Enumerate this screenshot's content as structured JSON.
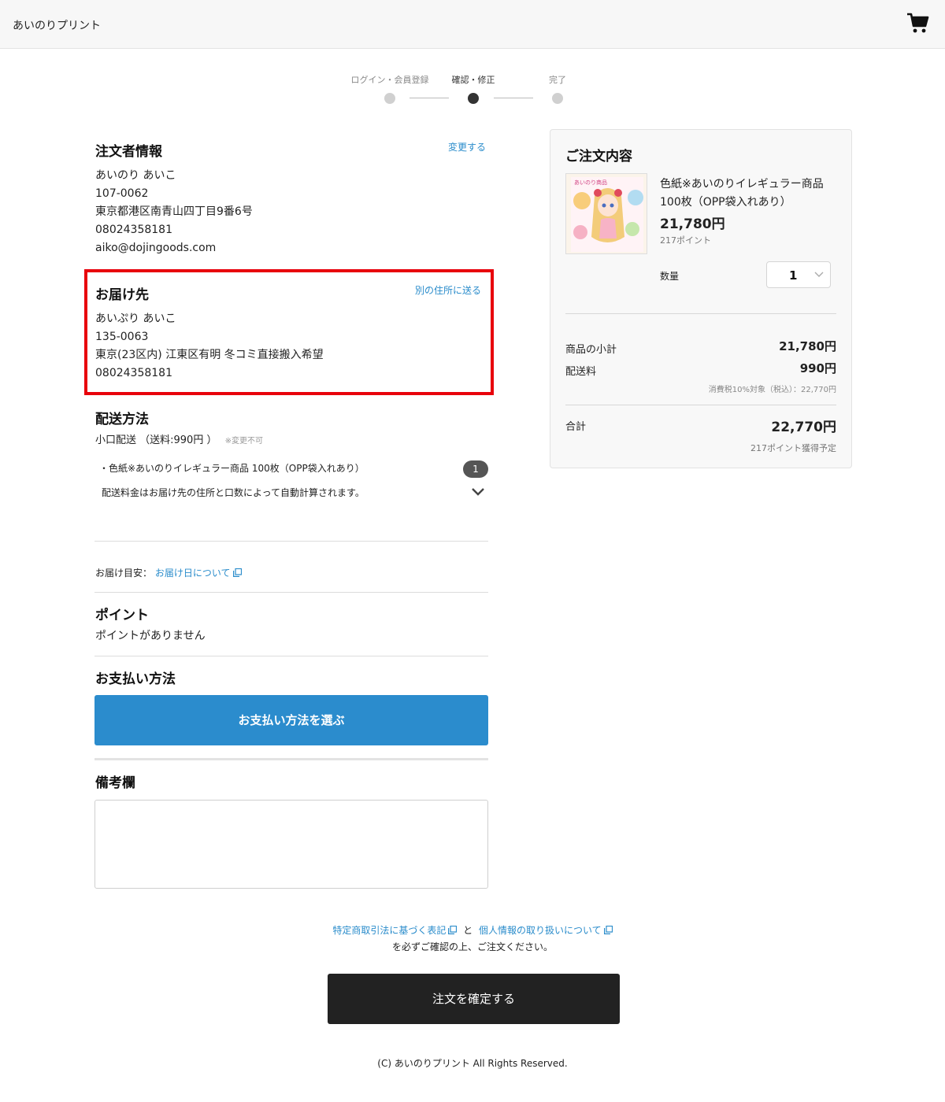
{
  "header": {
    "store_name": "あいのりプリント",
    "cart_icon": "cart-icon"
  },
  "stepper": {
    "steps": [
      {
        "label": "ログイン・会員登録",
        "state": "done"
      },
      {
        "label": "確認・修正",
        "state": "current"
      },
      {
        "label": "完了",
        "state": "pending"
      }
    ]
  },
  "orderer": {
    "title": "注文者情報",
    "change_link": "変更する",
    "name": "あいのり あいこ",
    "postal": "107-0062",
    "address": "東京都港区南青山四丁目9番6号",
    "phone": "08024358181",
    "email": "aiko@dojingoods.com"
  },
  "delivery": {
    "title": "お届け先",
    "alt_link": "別の住所に送る",
    "name": "あいぷり あいこ",
    "postal": "135-0063",
    "address": "東京(23区内) 江東区有明 冬コミ直接搬入希望",
    "phone": "08024358181"
  },
  "shipping": {
    "title": "配送方法",
    "method": "小口配送 （送料:990円 ）",
    "note": "※変更不可",
    "item": "・色紙※あいのりイレギュラー商品 100枚（OPP袋入れあり）",
    "item_count": "1",
    "auto_calc": "配送料金はお届け先の住所と口数によって自動計算されます。"
  },
  "eta": {
    "label": "お届け目安：",
    "link": "お届け日について"
  },
  "points": {
    "title": "ポイント",
    "text": "ポイントがありません"
  },
  "payment": {
    "title": "お支払い方法",
    "button": "お支払い方法を選ぶ"
  },
  "memo": {
    "title": "備考欄",
    "value": ""
  },
  "summary": {
    "title": "ご注文内容",
    "product_name_1": "色紙※あいのりイレギュラー商品",
    "product_name_2": "100枚（OPP袋入れあり）",
    "price": "21,780円",
    "points": "217ポイント",
    "qty_label": "数量",
    "qty_value": "1",
    "subtotal_label": "商品の小計",
    "subtotal": "21,780円",
    "shipping_label": "配送料",
    "shipping": "990円",
    "tax_note": "消費税10%対象（税込）：22,770円",
    "total_label": "合計",
    "total": "22,770円",
    "earn_points": "217ポイント獲得予定",
    "thumb_caption": "あいのり商品"
  },
  "legal": {
    "link1": "特定商取引法に基づく表記",
    "and": "と",
    "link2": "個人情報の取り扱いについて",
    "confirm_text": "を必ずご確認の上、ご注文ください。"
  },
  "confirm_button": "注文を確定する",
  "copyright": "(C) あいのりプリント All Rights Reserved.",
  "colors": {
    "accent_blue": "#2b8ccd",
    "link_blue": "#2a8ccb",
    "highlight_red": "#e8000b",
    "dark_button": "#222222"
  }
}
